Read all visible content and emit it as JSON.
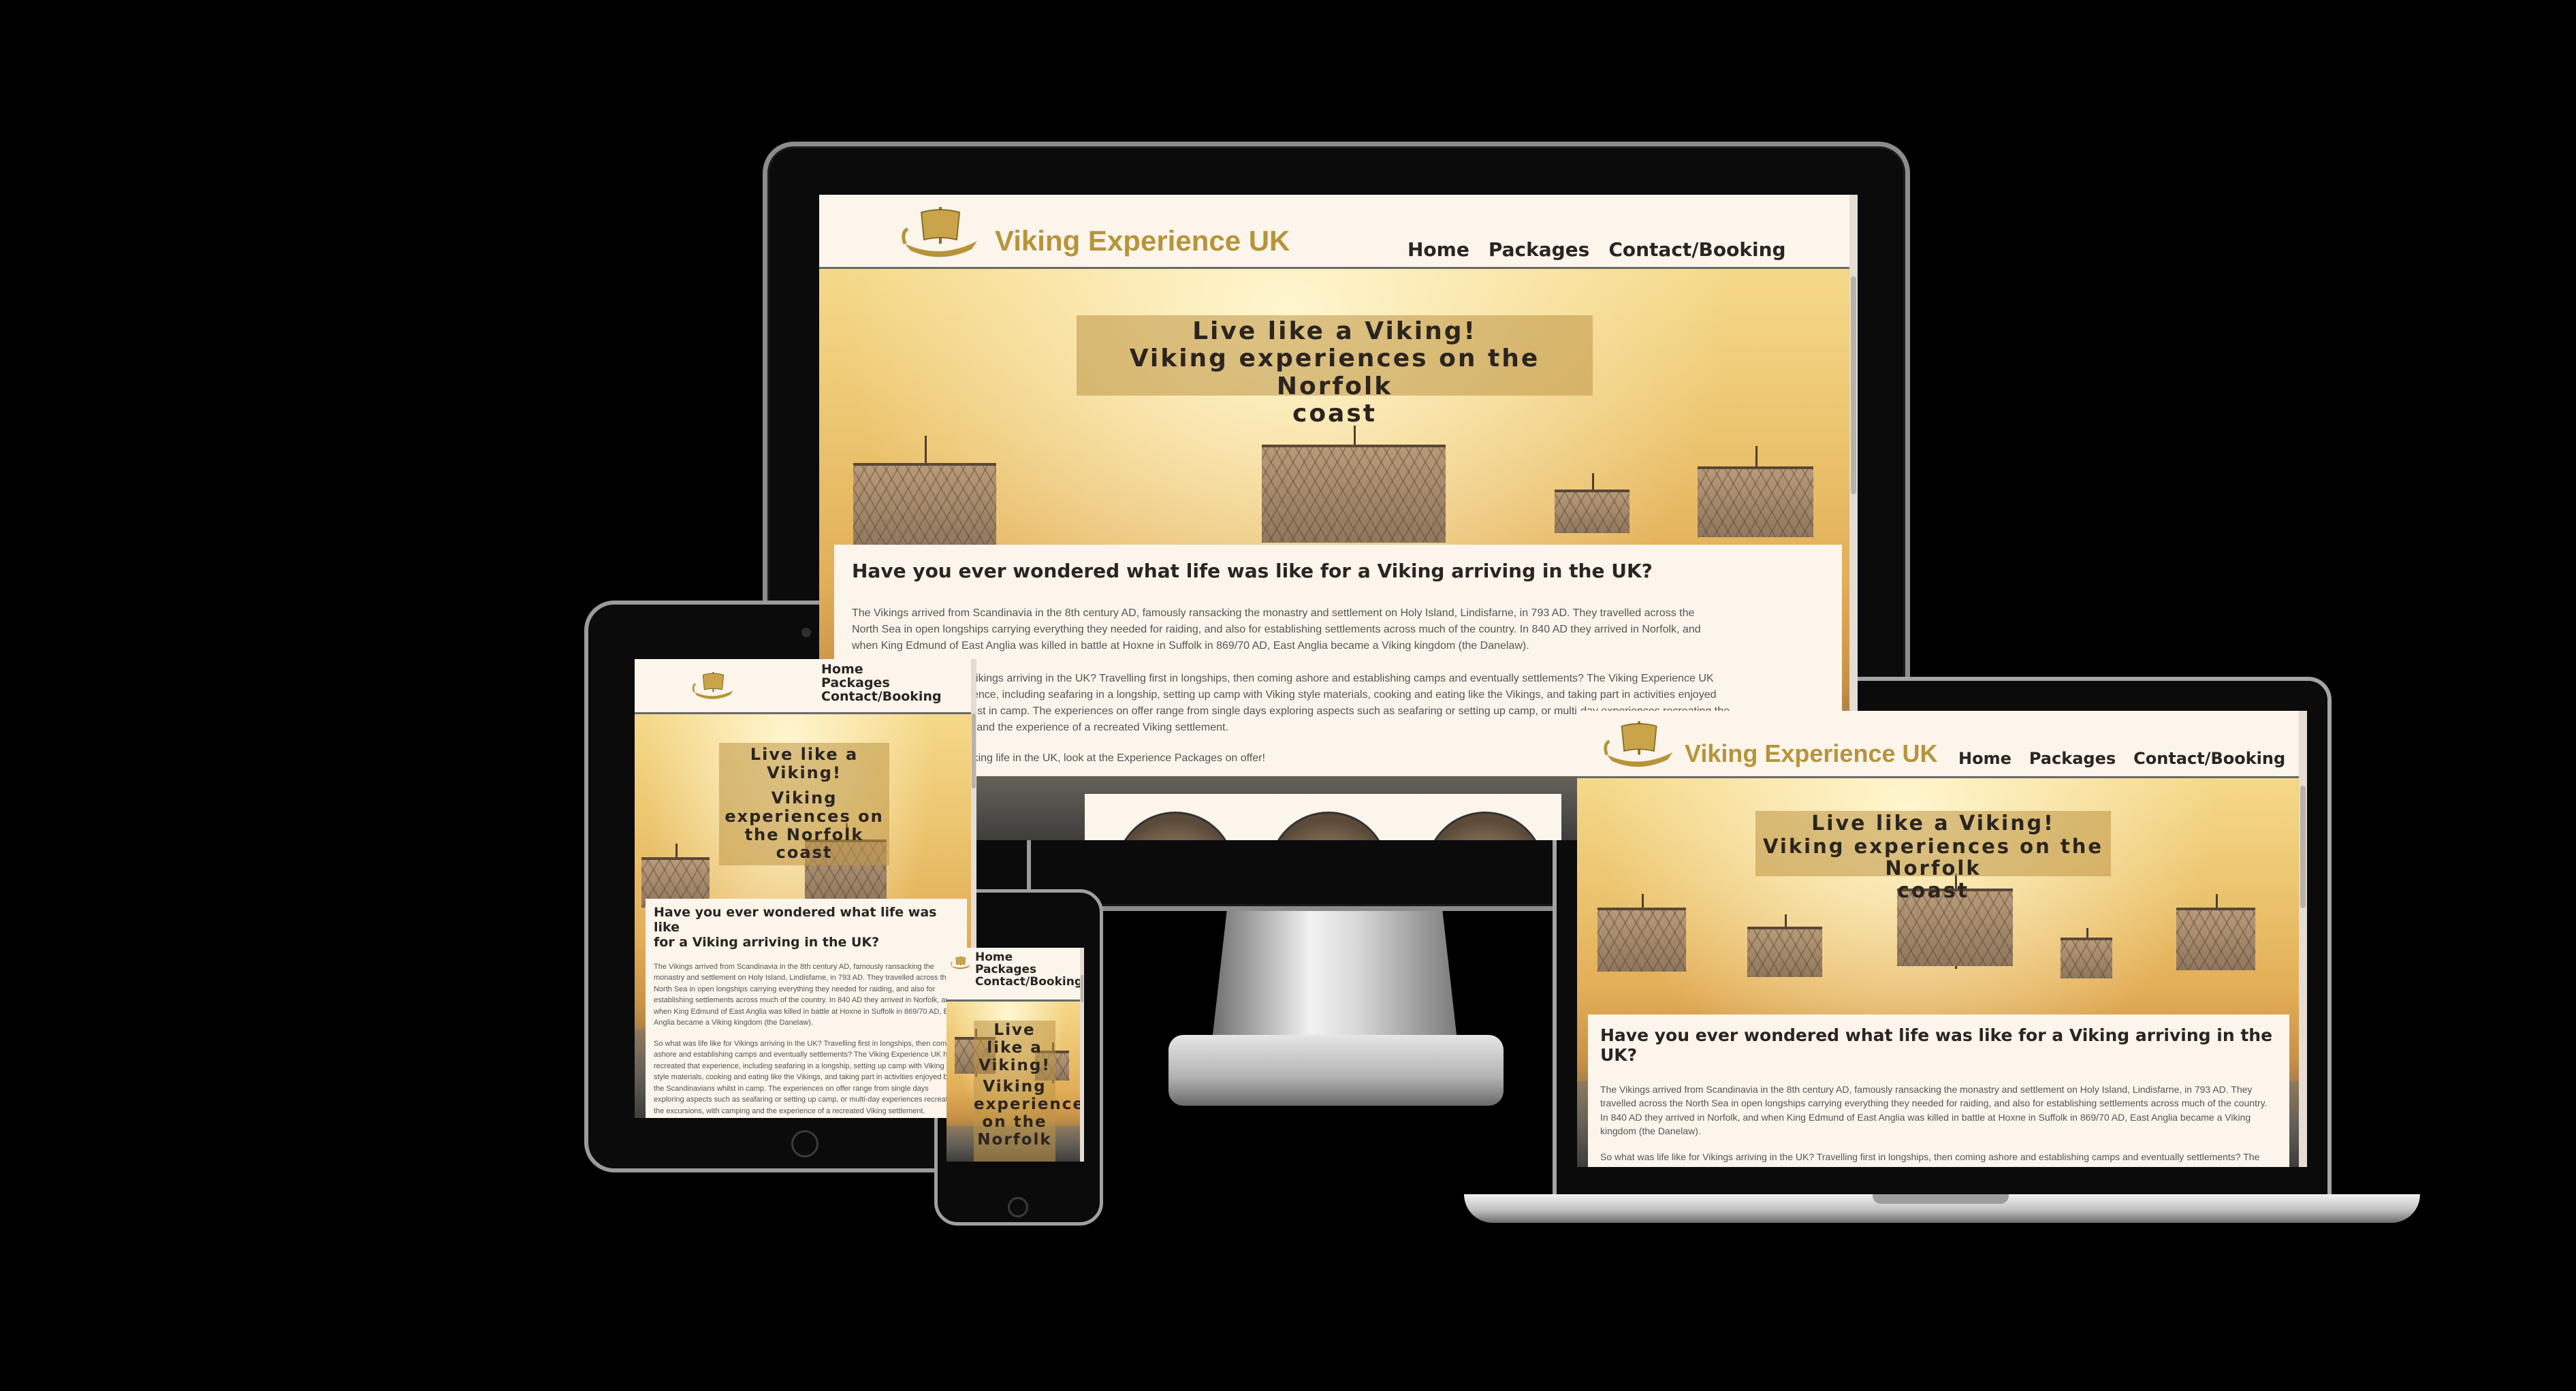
{
  "site": {
    "brand": "Viking Experience UK",
    "nav": [
      "Home",
      "Packages",
      "Contact/Booking"
    ],
    "tagline_line1": "Live like a Viking!",
    "tagline_line2": "Viking experiences on the Norfolk coast",
    "tagline_wide_line2a": "Viking experiences on the Norfolk",
    "tagline_wide_line2b": "coast",
    "tagline_tablet": [
      "Live like a",
      "Viking!",
      "Viking",
      "experiences on",
      "the Norfolk",
      "coast"
    ],
    "tagline_phone": [
      "Live",
      "like a",
      "Viking!",
      "Viking",
      "experiences",
      "on the",
      "Norfolk"
    ],
    "heading": "Have you ever wondered what life was like for a Viking arriving in the UK?",
    "tablet_heading_l1": "Have you ever wondered what life was like",
    "tablet_heading_l2": "for a Viking arriving in the UK?",
    "para1": "The Vikings arrived from Scandinavia in the 8th century AD, famously ransacking the monastry and settlement on Holy Island, Lindisfarne, in 793 AD. They travelled across the North Sea in open longships carrying everything they needed for raiding, and also for establishing settlements across much of the country. In 840 AD they arrived in Norfolk, and when King Edmund of East Anglia was killed in battle at Hoxne in Suffolk in 869/70 AD, East Anglia became a Viking kingdom (the Danelaw).",
    "para2": "So what was life like for Vikings arriving in the UK? Travelling first in longships, then coming ashore and establishing camps and eventually settlements? The Viking Experience UK has recreated that experience, including seafaring in a longship, setting up camp with Viking style materials, cooking and eating like the Vikings, and taking part in activities enjoyed by the Scandinavians whilst in camp. The experiences on offer range from single days exploring aspects such as seafaring or setting up camp, or multi-day experiences recreating the excursions, with camping and the experience of a recreated Viking settlement.",
    "para3": "To find out more about Viking life in the UK, look at the Experience Packages on offer!",
    "monitor_p1a": "The Vikings arrived from Scandinavia in the 8th century AD, famously ransacking the monastry and settlement on Holy Island, Lindisfarne, in 793 AD. They travelled across the",
    "monitor_p1b": "North Sea in open longships carrying everything they needed for raiding, and also for establishing settlements across much of the country. In 840 AD they arrived in Norfolk, and",
    "monitor_p1c": "when King Edmund of East Anglia was killed in battle at Hoxne in Suffolk in 869/70 AD, East Anglia became a Viking kingdom (the Danelaw).",
    "monitor_p2a": "So what was life like for Vikings arriving in the UK? Travelling first in longships, then coming ashore and establishing camps and eventually settlements? The Viking Experience UK",
    "monitor_p2b": "has recreated that experience, including seafaring in a longship, setting up camp with Viking style materials, cooking and eating like the Vikings, and taking part in activities enjoyed",
    "monitor_p2c": "by the Scandinavians whilst in camp. The experiences on offer range from single days exploring aspects such as seafaring or setting up camp, or multi-day experiences recreating the",
    "monitor_p2d": "excursions, with camping and the experience of a recreated Viking settlement.",
    "laptop_p2": "So what was life like for Vikings arriving in the UK? Travelling first in longships, then coming ashore and establishing camps and eventually settlements? The Viking Experience UK has recreated that experience, including seafaring in a longship, setting up camp with Viking style"
  },
  "icons": {
    "logo": "longship-logo-icon"
  },
  "colors": {
    "background": "#000000",
    "brand_gold": "#b7943a",
    "page": "#fbf5ec",
    "text": "#2b2420"
  }
}
